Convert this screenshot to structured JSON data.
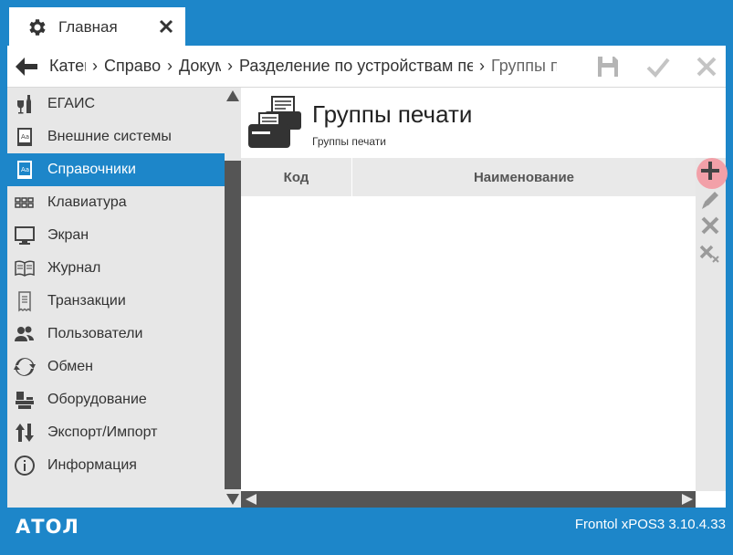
{
  "tab": {
    "title": "Главная",
    "icon": "gear-icon"
  },
  "breadcrumbs": [
    {
      "label": "Категории"
    },
    {
      "label": "Справочники"
    },
    {
      "label": "Документы"
    },
    {
      "label": "Разделение по устройствам печати"
    },
    {
      "label": "Группы печати"
    }
  ],
  "sidebar": {
    "items": [
      {
        "label": "ЕГАИС",
        "icon": "bottle-glass-icon"
      },
      {
        "label": "Внешние системы",
        "icon": "book-icon"
      },
      {
        "label": "Справочники",
        "icon": "reference-book-icon",
        "active": true
      },
      {
        "label": "Клавиатура",
        "icon": "keyboard-icon"
      },
      {
        "label": "Экран",
        "icon": "monitor-icon"
      },
      {
        "label": "Журнал",
        "icon": "journal-icon"
      },
      {
        "label": "Транзакции",
        "icon": "receipt-icon"
      },
      {
        "label": "Пользователи",
        "icon": "users-icon"
      },
      {
        "label": "Обмен",
        "icon": "sync-icon"
      },
      {
        "label": "Оборудование",
        "icon": "equipment-icon"
      },
      {
        "label": "Экспорт/Импорт",
        "icon": "import-export-icon"
      },
      {
        "label": "Информация",
        "icon": "info-icon"
      }
    ]
  },
  "main": {
    "title": "Группы печати",
    "subtitle": "Группы печати",
    "columns": [
      "Код",
      "Наименование"
    ],
    "rows": []
  },
  "footer": {
    "logo": "АТОЛ",
    "version": "Frontol xPOS3 3.10.4.33"
  },
  "colors": {
    "accent": "#1d86c9",
    "sidebar_bg": "#e7e7e7",
    "add_highlight": "#f2a0a8"
  }
}
